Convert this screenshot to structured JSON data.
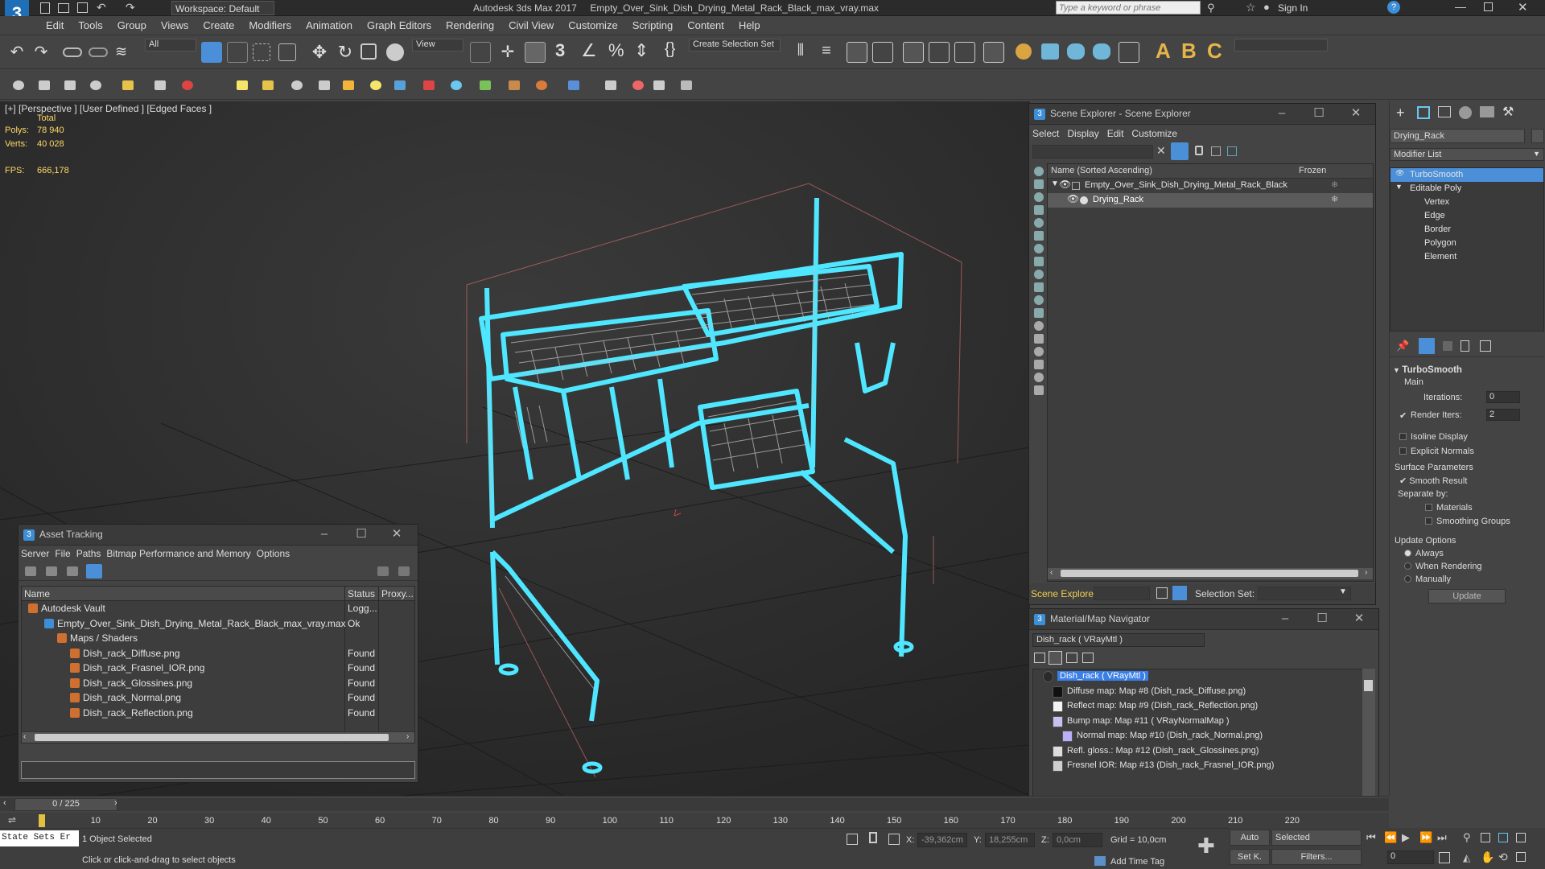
{
  "app": {
    "title": "Autodesk 3ds Max 2017",
    "file": "Empty_Over_Sink_Dish_Drying_Metal_Rack_Black_max_vray.max",
    "workspace": "Workspace: Default",
    "search_placeholder": "Type a keyword or phrase",
    "sign_in": "Sign In"
  },
  "menu": [
    "Edit",
    "Tools",
    "Group",
    "Views",
    "Create",
    "Modifiers",
    "Animation",
    "Graph Editors",
    "Rendering",
    "Civil View",
    "Customize",
    "Scripting",
    "Content",
    "Help"
  ],
  "toolbar": {
    "filter": "All",
    "view": "View",
    "selection_set": "Create Selection Set"
  },
  "viewport": {
    "label": "[+] [Perspective ] [User Defined ] [Edged Faces ]",
    "total": "Total",
    "polys_label": "Polys:",
    "polys": "78 940",
    "verts_label": "Verts:",
    "verts": "40 028",
    "fps_label": "FPS:",
    "fps": "666,178"
  },
  "scene_explorer": {
    "title": "Scene Explorer - Scene Explorer",
    "menu": [
      "Select",
      "Display",
      "Edit",
      "Customize"
    ],
    "col_name": "Name (Sorted Ascending)",
    "col_frozen": "Frozen",
    "items": [
      "Empty_Over_Sink_Dish_Drying_Metal_Rack_Black",
      "Drying_Rack"
    ],
    "footer_label": "Scene Explorer",
    "selection_set_label": "Selection Set:"
  },
  "asset_tracking": {
    "title": "Asset Tracking",
    "menu": [
      "Server",
      "File",
      "Paths",
      "Bitmap Performance and Memory",
      "Options"
    ],
    "cols": [
      "Name",
      "Status",
      "Proxy..."
    ],
    "rows": [
      {
        "name": "Autodesk Vault",
        "status": "Logg..."
      },
      {
        "name": "Empty_Over_Sink_Dish_Drying_Metal_Rack_Black_max_vray.max",
        "status": "Ok"
      },
      {
        "name": "Maps / Shaders",
        "status": ""
      },
      {
        "name": "Dish_rack_Diffuse.png",
        "status": "Found"
      },
      {
        "name": "Dish_rack_Frasnel_IOR.png",
        "status": "Found"
      },
      {
        "name": "Dish_rack_Glossines.png",
        "status": "Found"
      },
      {
        "name": "Dish_rack_Normal.png",
        "status": "Found"
      },
      {
        "name": "Dish_rack_Reflection.png",
        "status": "Found"
      }
    ]
  },
  "material_navigator": {
    "title": "Material/Map Navigator",
    "current": "Dish_rack  ( VRayMtl )",
    "items": [
      "Dish_rack  ( VRayMtl )",
      "Diffuse map: Map #8 (Dish_rack_Diffuse.png)",
      "Reflect map: Map #9 (Dish_rack_Reflection.png)",
      "Bump map: Map #11  ( VRayNormalMap )",
      "Normal map: Map #10 (Dish_rack_Normal.png)",
      "Refl. gloss.: Map #12 (Dish_rack_Glossines.png)",
      "Fresnel IOR: Map #13 (Dish_rack_Frasnel_IOR.png)"
    ]
  },
  "command_panel": {
    "object_name": "Drying_Rack",
    "modifier_list": "Modifier List",
    "stack": [
      "TurboSmooth",
      "Editable Poly",
      "Vertex",
      "Edge",
      "Border",
      "Polygon",
      "Element"
    ],
    "rollout": "TurboSmooth",
    "main": "Main",
    "iterations_label": "Iterations:",
    "iterations": "0",
    "render_iters_label": "Render Iters:",
    "render_iters": "2",
    "isoline": "Isoline Display",
    "explicit_normals": "Explicit Normals",
    "surface_params": "Surface Parameters",
    "smooth_result": "Smooth Result",
    "separate_by": "Separate by:",
    "materials": "Materials",
    "smoothing_groups": "Smoothing Groups",
    "update_options": "Update Options",
    "always": "Always",
    "when_rendering": "When Rendering",
    "manually": "Manually",
    "update": "Update"
  },
  "timeline": {
    "frame": "0 / 225",
    "ticks": [
      "10",
      "20",
      "30",
      "40",
      "50",
      "60",
      "70",
      "80",
      "90",
      "100",
      "110",
      "120",
      "130",
      "140",
      "150",
      "160",
      "170",
      "180",
      "190",
      "200",
      "210",
      "220"
    ]
  },
  "status": {
    "script_label": "State Sets Er",
    "selected": "1 Object Selected",
    "hint": "Click or click-and-drag to select objects",
    "x_label": "X:",
    "x": "-39,362cm",
    "y_label": "Y:",
    "y": "18,255cm",
    "z_label": "Z:",
    "z": "0,0cm",
    "grid": "Grid = 10,0cm",
    "add_time_tag": "Add Time Tag",
    "auto": "Auto",
    "selected_mode": "Selected",
    "set_k": "Set K.",
    "filters": "Filters...",
    "frame_field": "0"
  }
}
